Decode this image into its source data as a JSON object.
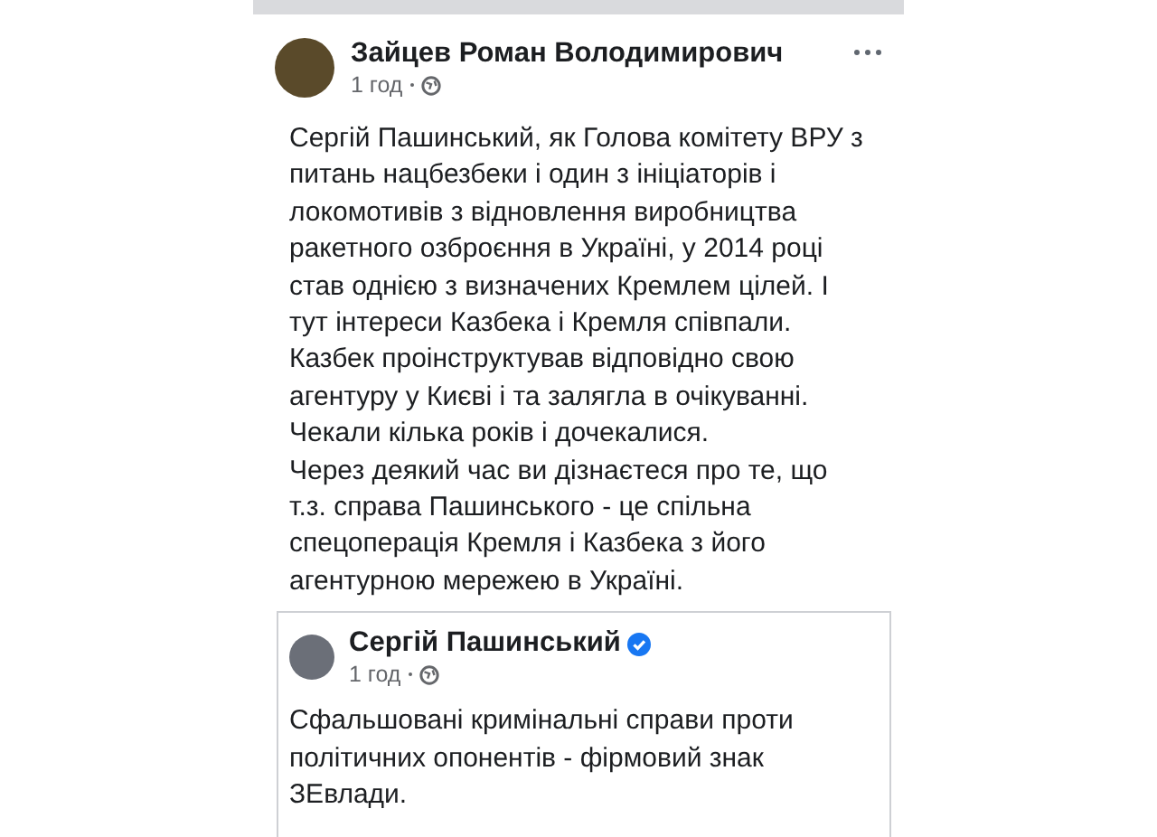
{
  "post": {
    "author": "Зайцев Роман Володимирович",
    "time": "1 год",
    "text": "Сергій Пашинський, як Голова комітету ВРУ з\nпитань нацбезбеки і один з ініціаторів і\nлокомотивів з відновлення виробництва\nракетного озброєння в Україні, у 2014 році\nстав однією з визначених Кремлем цілей. І\nтут інтереси Казбека і Кремля співпали.\nКазбек проінструктував відповідно свою\nагентуру у Києві і та залягла в очікуванні.\nЧекали кілька років і дочекалися.\nЧерез деякий час ви дізнаєтеся про те, що\nт.з. справа Пашинського - це спільна\nспецоперація Кремля і Казбека з його\nагентурною мережею в Україні."
  },
  "shared_post": {
    "author": "Сергій Пашинський",
    "verified": true,
    "time": "1 год",
    "text": "Сфальшовані кримінальні справи проти\nполітичних опонентів - фірмовий знак\nЗЕвлади."
  }
}
